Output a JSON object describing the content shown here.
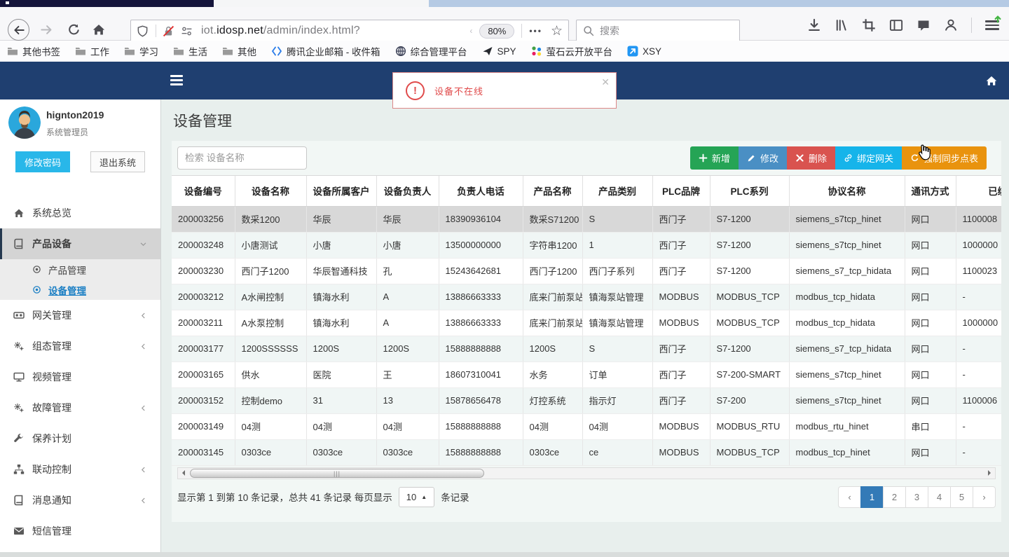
{
  "browser": {
    "toolbar": {
      "url_subdomain": "iot.",
      "url_domain": "idosp.net",
      "url_path": "/admin/index.html?",
      "zoom_badge": "80%",
      "search_placeholder": "搜索"
    },
    "bookmarks": [
      {
        "icon": "folder",
        "label": "其他书签"
      },
      {
        "icon": "folder",
        "label": "工作"
      },
      {
        "icon": "folder",
        "label": "学习"
      },
      {
        "icon": "folder",
        "label": "生活"
      },
      {
        "icon": "folder",
        "label": "其他"
      },
      {
        "icon": "tencent-mail",
        "label": "腾讯企业邮箱 - 收件箱"
      },
      {
        "icon": "globe",
        "label": "综合管理平台"
      },
      {
        "icon": "plane",
        "label": "SPY"
      },
      {
        "icon": "ys-cloud",
        "label": "萤石云开放平台"
      },
      {
        "icon": "xsy",
        "label": "XSY"
      }
    ]
  },
  "alert": {
    "text": "设备不在线"
  },
  "colors": {
    "navbar": "#1f3f70",
    "change_password": "#29b7e9",
    "pager_active": "#337ab7",
    "alert": "#e04b4b"
  },
  "sidebar": {
    "username": "hignton2019",
    "role": "系统管理员",
    "change_password": "修改密码",
    "logout": "退出系统",
    "menu": [
      {
        "icon": "home",
        "label": "系统总览"
      },
      {
        "icon": "book",
        "label": "产品设备",
        "state": "expanded",
        "children": [
          {
            "icon": "target",
            "label": "产品管理",
            "active": false
          },
          {
            "icon": "target",
            "label": "设备管理",
            "active": true
          }
        ]
      },
      {
        "icon": "gateway",
        "label": "网关管理",
        "state": "collapsed"
      },
      {
        "icon": "gears",
        "label": "组态管理",
        "state": "collapsed"
      },
      {
        "icon": "monitor",
        "label": "视频管理"
      },
      {
        "icon": "gears",
        "label": "故障管理",
        "state": "collapsed"
      },
      {
        "icon": "wrench",
        "label": "保养计划"
      },
      {
        "icon": "sitemap",
        "label": "联动控制",
        "state": "collapsed"
      },
      {
        "icon": "book",
        "label": "消息通知",
        "state": "collapsed"
      },
      {
        "icon": "envelope",
        "label": "短信管理"
      }
    ]
  },
  "page": {
    "title": "设备管理",
    "search_placeholder": "检索 设备名称",
    "toolbar_buttons": [
      {
        "icon": "plus",
        "label": "新增",
        "color": "#25a455"
      },
      {
        "icon": "pencil",
        "label": "修改",
        "color": "#4a8fc4"
      },
      {
        "icon": "xmark",
        "label": "删除",
        "color": "#d9534f"
      },
      {
        "icon": "link",
        "label": "绑定网关",
        "color": "#16b4ea"
      },
      {
        "icon": "refresh",
        "label": "强制同步点表",
        "color": "#e9930e"
      }
    ],
    "table": {
      "columns": [
        "设备编号",
        "设备名称",
        "设备所属客户",
        "设备负责人",
        "负责人电话",
        "产品名称",
        "产品类别",
        "PLC品牌",
        "PLC系列",
        "协议名称",
        "通讯方式",
        "已绑定网关"
      ],
      "selected_row": 0,
      "rows": [
        [
          "200003256",
          "数采1200",
          "华辰",
          "华辰",
          "18390936104",
          "数采S71200",
          "S",
          "西门子",
          "S7-1200",
          "siemens_s7tcp_hinet",
          "网口",
          "1100008"
        ],
        [
          "200003248",
          "小唐测试",
          "小唐",
          "小唐",
          "13500000000",
          "字符串1200",
          "1",
          "西门子",
          "S7-1200",
          "siemens_s7tcp_hinet",
          "网口",
          "1000000"
        ],
        [
          "200003230",
          "西门子1200",
          "华辰智通科技",
          "孔",
          "15243642681",
          "西门子1200",
          "西门子系列",
          "西门子",
          "S7-1200",
          "siemens_s7_tcp_hidata",
          "网口",
          "1100023"
        ],
        [
          "200003212",
          "A水闸控制",
          "镇海水利",
          "A",
          "13886663333",
          "底来门前泵站",
          "镇海泵站管理",
          "MODBUS",
          "MODBUS_TCP",
          "modbus_tcp_hidata",
          "网口",
          "-"
        ],
        [
          "200003211",
          "A水泵控制",
          "镇海水利",
          "A",
          "13886663333",
          "底来门前泵站",
          "镇海泵站管理",
          "MODBUS",
          "MODBUS_TCP",
          "modbus_tcp_hidata",
          "网口",
          "1000000"
        ],
        [
          "200003177",
          "1200SSSSSS",
          "1200S",
          "1200S",
          "15888888888",
          "1200S",
          "S",
          "西门子",
          "S7-1200",
          "siemens_s7_tcp_hidata",
          "网口",
          "-"
        ],
        [
          "200003165",
          "供水",
          "医院",
          "王",
          "18607310041",
          "水务",
          "订单",
          "西门子",
          "S7-200-SMART",
          "siemens_s7tcp_hinet",
          "网口",
          "-"
        ],
        [
          "200003152",
          "控制demo",
          "31",
          "13",
          "15878656478",
          "灯控系统",
          "指示灯",
          "西门子",
          "S7-200",
          "siemens_s7tcp_hinet",
          "网口",
          "1100006"
        ],
        [
          "200003149",
          "04测",
          "04测",
          "04测",
          "15888888888",
          "04测",
          "04测",
          "MODBUS",
          "MODBUS_RTU",
          "modbus_rtu_hinet",
          "串口",
          "-"
        ],
        [
          "200003145",
          "0303ce",
          "0303ce",
          "0303ce",
          "15888888888",
          "0303ce",
          "ce",
          "MODBUS",
          "MODBUS_TCP",
          "modbus_tcp_hinet",
          "网口",
          "-"
        ]
      ]
    },
    "pagination": {
      "info_before": "显示第 1 到第 10 条记录，总共 41 条记录 每页显示",
      "page_size": "10",
      "info_after": "条记录",
      "prev": "‹",
      "next": "›",
      "pages": [
        "1",
        "2",
        "3",
        "4",
        "5"
      ],
      "active_page": "1"
    }
  }
}
